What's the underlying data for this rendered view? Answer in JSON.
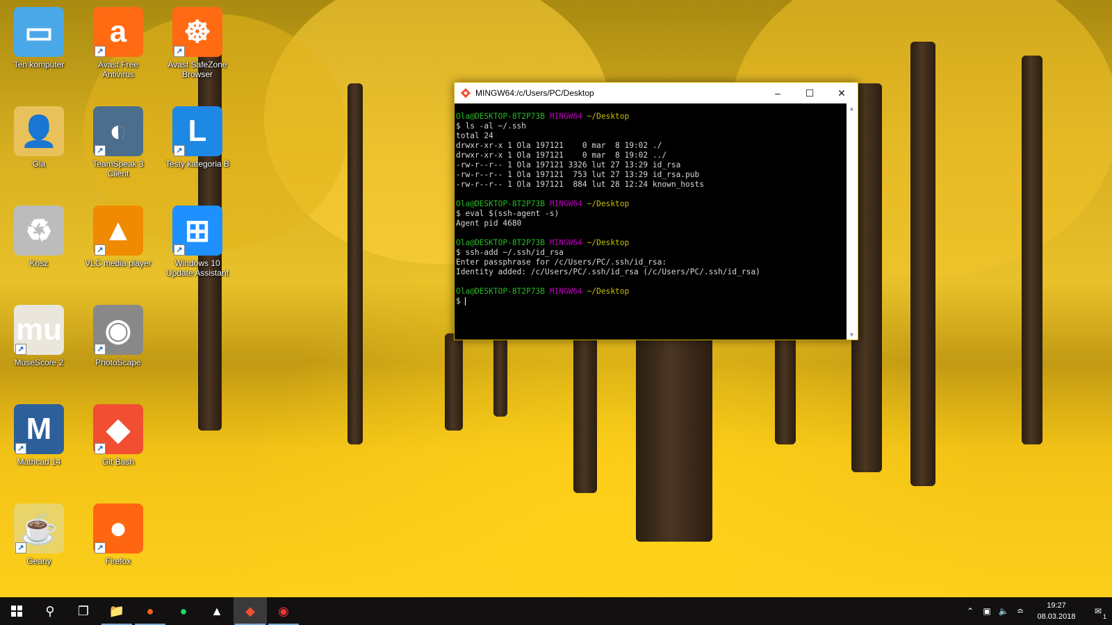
{
  "desktop": {
    "icons": [
      {
        "label": "Ten komputer",
        "symbol": "▭",
        "color": "#4aa8e8"
      },
      {
        "label": "Avast Free Antivirus",
        "symbol": "a",
        "color": "#ff6a13"
      },
      {
        "label": "Avast SafeZone Browser",
        "symbol": "☸",
        "color": "#ff6a13"
      },
      {
        "label": "Ola",
        "symbol": "👤",
        "color": "#e8c15a"
      },
      {
        "label": "TeamSpeak 3 Client",
        "symbol": "◐",
        "color": "#4b6e8c"
      },
      {
        "label": "Testy kategoria B",
        "symbol": "L",
        "color": "#1e88e5"
      },
      {
        "label": "Kosz",
        "symbol": "♻",
        "color": "#bcbcbc"
      },
      {
        "label": "VLC media player",
        "symbol": "▲",
        "color": "#f08a00"
      },
      {
        "label": "Windows 10 Update Assistant",
        "symbol": "⊞",
        "color": "#1e90ff"
      },
      {
        "label": "MuseScore 2",
        "symbol": "mu",
        "color": "#eae6db"
      },
      {
        "label": "PhotoScape",
        "symbol": "◉",
        "color": "#888"
      },
      {
        "label": "Mathcad 14",
        "symbol": "M",
        "color": "#2d5f9a"
      },
      {
        "label": "Git Bash",
        "symbol": "◆",
        "color": "#f14e32"
      },
      {
        "label": "Geany",
        "symbol": "☕",
        "color": "#e9d46a"
      },
      {
        "label": "Firefox",
        "symbol": "●",
        "color": "#ff6611"
      }
    ]
  },
  "terminal": {
    "title": "MINGW64:/c/Users/PC/Desktop",
    "prompt": {
      "user": "Ola@DESKTOP-8T2P73B",
      "host": "MINGW64",
      "dir": "~/Desktop"
    },
    "blocks": [
      {
        "command": "$ ls -al ~/.ssh",
        "output": "total 24\ndrwxr-xr-x 1 Ola 197121    0 mar  8 19:02 ./\ndrwxr-xr-x 1 Ola 197121    0 mar  8 19:02 ../\n-rw-r--r-- 1 Ola 197121 3326 lut 27 13:29 id_rsa\n-rw-r--r-- 1 Ola 197121  753 lut 27 13:29 id_rsa.pub\n-rw-r--r-- 1 Ola 197121  884 lut 28 12:24 known_hosts"
      },
      {
        "command": "$ eval $(ssh-agent -s)",
        "output": "Agent pid 4680"
      },
      {
        "command": "$ ssh-add ~/.ssh/id_rsa",
        "output": "Enter passphrase for /c/Users/PC/.ssh/id_rsa:\nIdentity added: /c/Users/PC/.ssh/id_rsa (/c/Users/PC/.ssh/id_rsa)"
      }
    ],
    "current_prompt": "$ "
  },
  "taskbar": {
    "clock_time": "19:27",
    "clock_date": "08.03.2018",
    "notification_count": "1"
  }
}
